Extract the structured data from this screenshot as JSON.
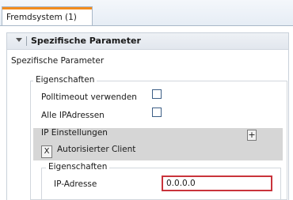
{
  "tab": {
    "label": "Fremdsystem (1)",
    "accent_color": "#f28c1e"
  },
  "panel": {
    "header_title": "Spezifische Parameter",
    "subtitle": "Spezifische Parameter",
    "collapse_icon": "triangle-down-icon"
  },
  "properties": {
    "legend": "Eigenschaften",
    "polltimeout_label": "Polltimeout verwenden",
    "polltimeout_checked": false,
    "all_ip_label": "Alle IPAdressen",
    "all_ip_checked": false
  },
  "ip_settings": {
    "title": "IP Einstellungen",
    "add_label": "+",
    "remove_label": "X",
    "client_label": "Autorisierter Client",
    "background": "#d6d6d6"
  },
  "client_properties": {
    "legend": "Eigenschaften",
    "ip_label": "IP-Adresse",
    "ip_value": "0.0.0.0",
    "error_color": "#c9333b"
  }
}
